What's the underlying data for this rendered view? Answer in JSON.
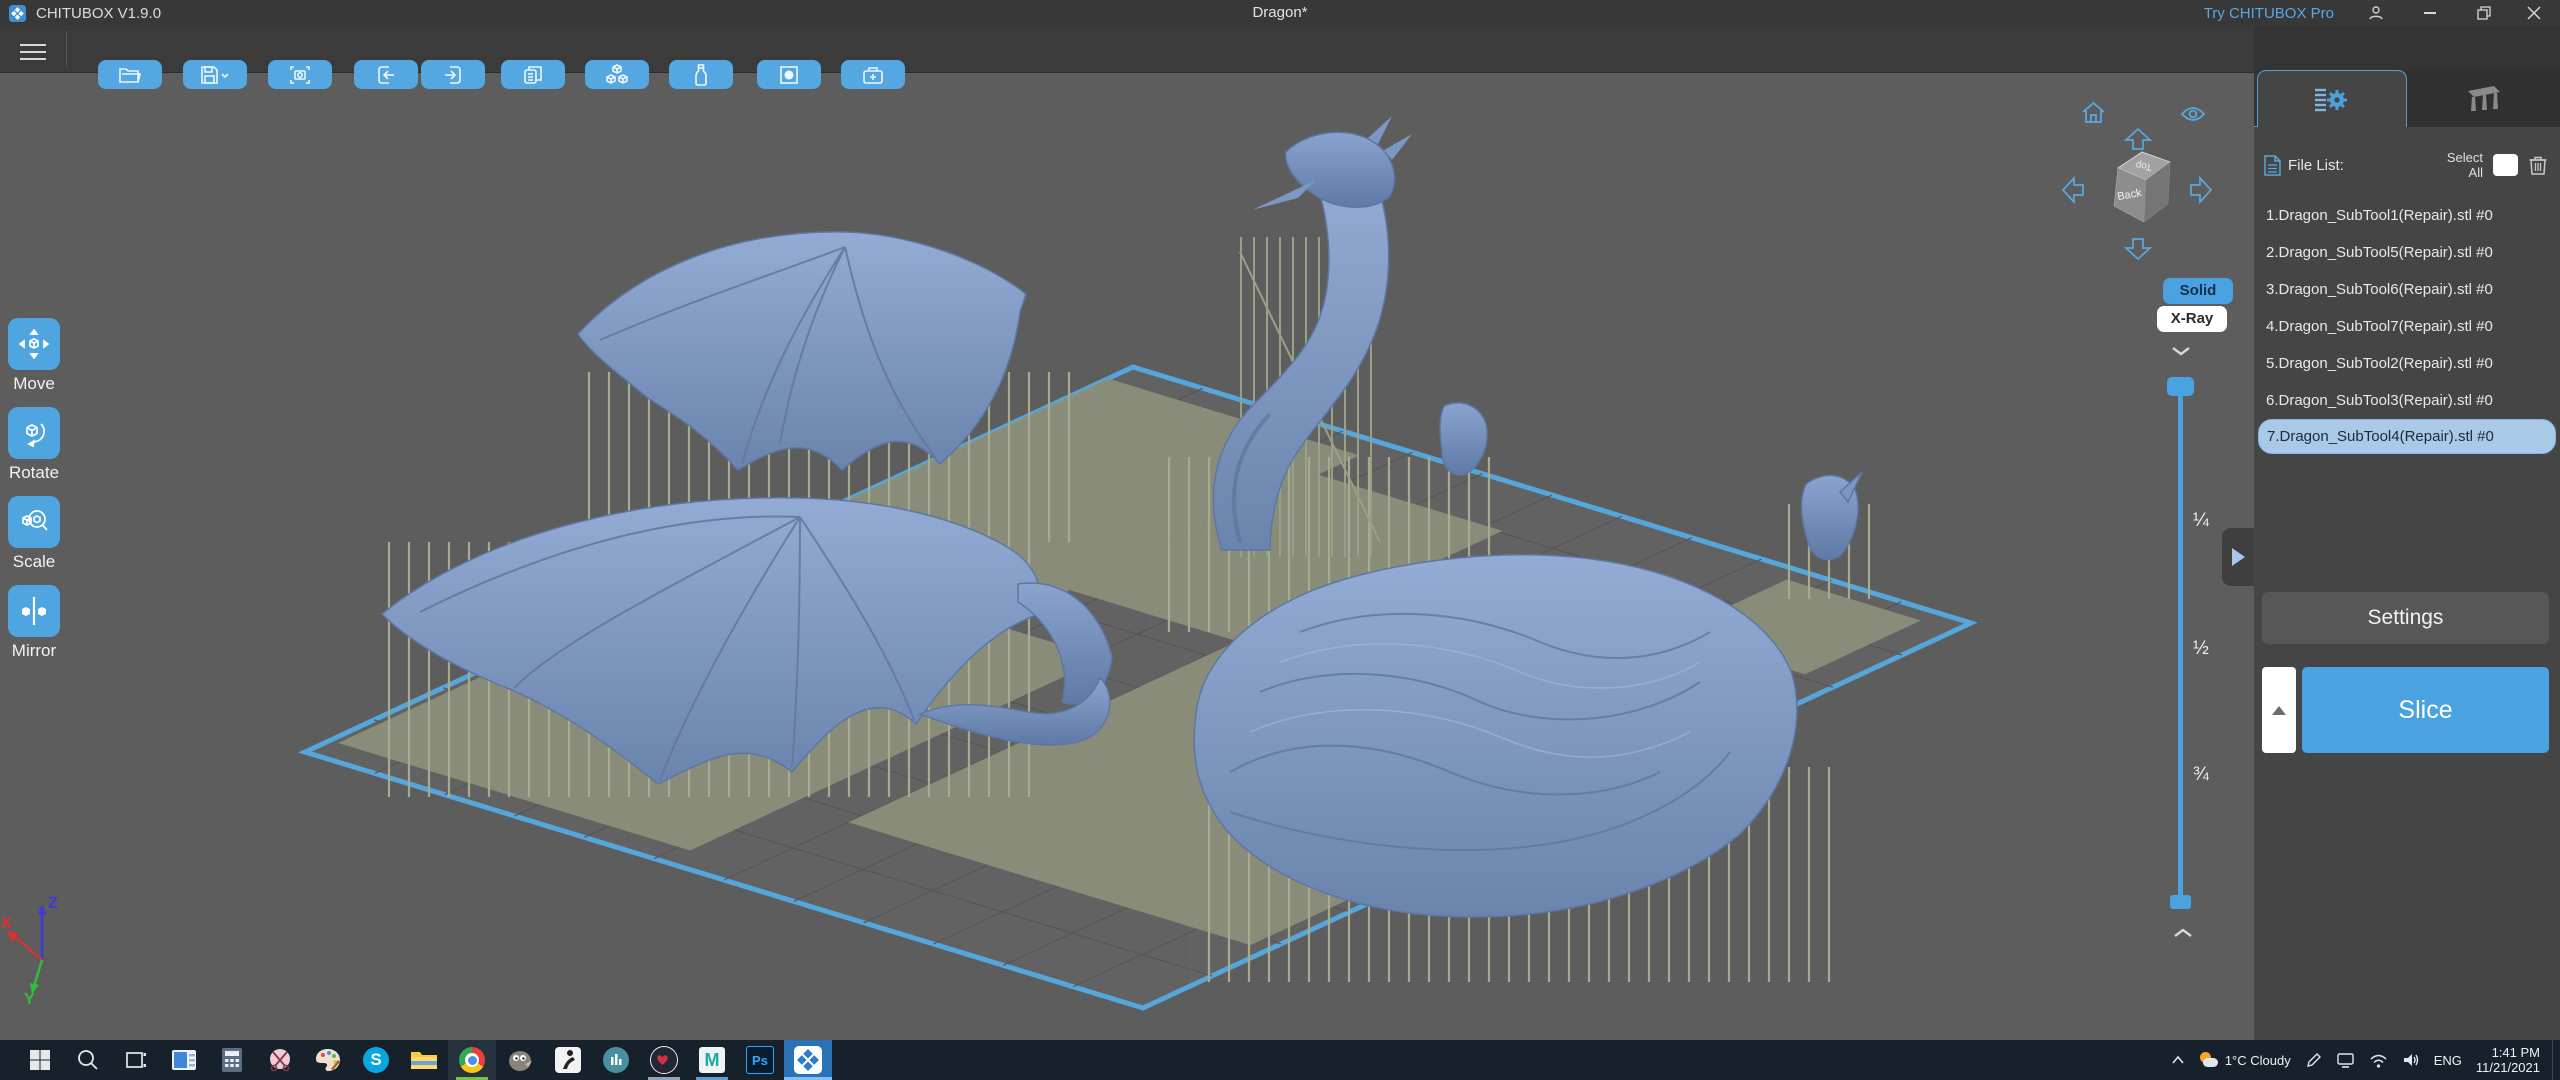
{
  "titlebar": {
    "app_title": "CHITUBOX V1.9.0",
    "document_title": "Dragon*",
    "pro_link": "Try CHITUBOX Pro"
  },
  "toolbar": {
    "buttons": [
      "open-file",
      "save",
      "snapshot",
      "import",
      "export",
      "copy",
      "auto-arrange",
      "resin-settings",
      "dig-hole",
      "toolbox"
    ]
  },
  "left_toolbar": {
    "tools": [
      {
        "label": "Move"
      },
      {
        "label": "Rotate"
      },
      {
        "label": "Scale"
      },
      {
        "label": "Mirror"
      }
    ]
  },
  "viewport": {
    "view_cube": {
      "top_face": "Top",
      "front_face": "Back"
    },
    "render_modes": {
      "solid": "Solid",
      "xray": "X-Ray"
    },
    "height_slider": {
      "marks": [
        "¼",
        "½",
        "¾"
      ]
    },
    "axis_gizmo": {
      "x": "X",
      "y": "Y",
      "z": "Z"
    }
  },
  "right_panel": {
    "tabs": [
      "file-settings",
      "support"
    ],
    "file_list": {
      "label": "File List:",
      "select_all_label": "Select All",
      "items": [
        "1.Dragon_SubTool1(Repair).stl #0",
        "2.Dragon_SubTool5(Repair).stl #0",
        "3.Dragon_SubTool6(Repair).stl #0",
        "4.Dragon_SubTool7(Repair).stl #0",
        "5.Dragon_SubTool2(Repair).stl #0",
        "6.Dragon_SubTool3(Repair).stl #0",
        "7.Dragon_SubTool4(Repair).stl #0"
      ],
      "selected_index": 6
    },
    "settings_button": "Settings",
    "slice_button": "Slice"
  },
  "taskbar": {
    "pinned_apps": [
      "windows-start",
      "search",
      "task-view",
      "photos",
      "calculator",
      "snipping-tool",
      "paint",
      "skype",
      "file-explorer",
      "chrome",
      "gimp",
      "zbrush",
      "music",
      "medibang",
      "maya",
      "photoshop",
      "chitubox"
    ],
    "tray": {
      "weather": "1°C Cloudy",
      "language": "ENG",
      "time": "1:41 PM",
      "date": "11/21/2021"
    }
  },
  "colors": {
    "accent": "#4BA3E0",
    "toolbar_button": "#54A7E0",
    "selected_file_bg": "#A9C9E9",
    "slice_button": "#4AA3E0",
    "taskbar_bg": "#16212C"
  }
}
